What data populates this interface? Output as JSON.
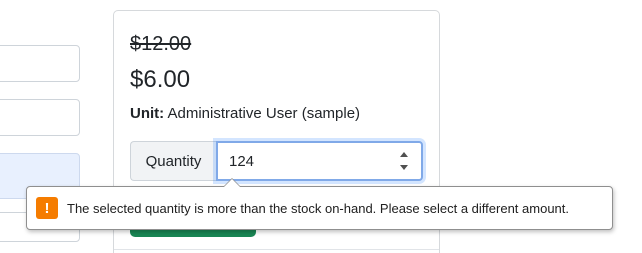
{
  "product": {
    "original_price": "$12.00",
    "sale_price": "$6.00",
    "unit_label": "Unit:",
    "unit_value": "Administrative User (sample)"
  },
  "quantity": {
    "label": "Quantity",
    "value": "124"
  },
  "validation": {
    "message": "The selected quantity is more than the stock on-hand. Please select a different amount.",
    "icon": "warning-icon",
    "icon_glyph": "!",
    "icon_color": "#f57c00"
  },
  "colors": {
    "primary_action": "#198754",
    "focus_ring": "#80a9e8"
  }
}
